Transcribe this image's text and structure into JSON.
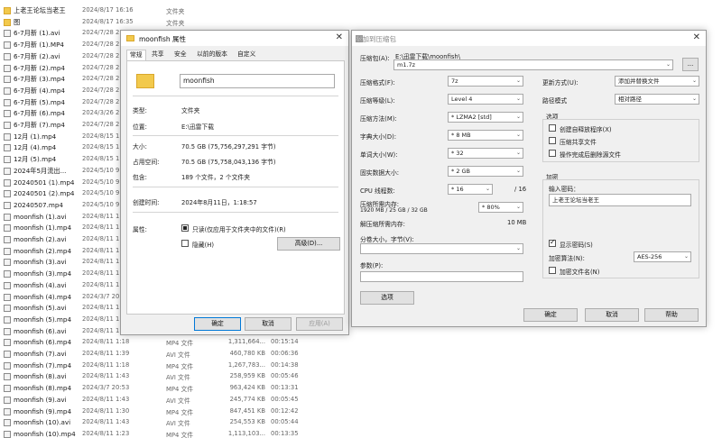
{
  "explorer": {
    "rows": [
      {
        "name": "上老王论坛当老王",
        "date": "2024/8/17 16:16",
        "type": "文件夹",
        "size": "",
        "duration": "",
        "icon": "folder"
      },
      {
        "name": "图",
        "date": "2024/8/17 16:35",
        "type": "文件夹",
        "size": "",
        "duration": "",
        "icon": "folder"
      },
      {
        "name": "6-7月新 (1).avi",
        "date": "2024/7/28 2",
        "type": "",
        "size": "",
        "duration": "",
        "icon": "file"
      },
      {
        "name": "6-7月新 (1).MP4",
        "date": "2024/7/28 2",
        "type": "",
        "size": "",
        "duration": "",
        "icon": "file"
      },
      {
        "name": "6-7月新 (2).avi",
        "date": "2024/7/28 2",
        "type": "",
        "size": "",
        "duration": "",
        "icon": "file"
      },
      {
        "name": "6-7月新 (2).mp4",
        "date": "2024/7/28 2",
        "type": "",
        "size": "",
        "duration": "",
        "icon": "file"
      },
      {
        "name": "6-7月新 (3).mp4",
        "date": "2024/7/28 2",
        "type": "",
        "size": "",
        "duration": "",
        "icon": "file"
      },
      {
        "name": "6-7月新 (4).mp4",
        "date": "2024/7/28 2",
        "type": "",
        "size": "",
        "duration": "",
        "icon": "file"
      },
      {
        "name": "6-7月新 (5).mp4",
        "date": "2024/7/28 2",
        "type": "",
        "size": "",
        "duration": "",
        "icon": "file"
      },
      {
        "name": "6-7月新 (6).mp4",
        "date": "2024/3/26 2",
        "type": "",
        "size": "",
        "duration": "",
        "icon": "file"
      },
      {
        "name": "6-7月新 (7).mp4",
        "date": "2024/7/28 2",
        "type": "",
        "size": "",
        "duration": "",
        "icon": "file"
      },
      {
        "name": "12月 (1).mp4",
        "date": "2024/8/15 1",
        "type": "",
        "size": "",
        "duration": "",
        "icon": "file"
      },
      {
        "name": "12月 (4).mp4",
        "date": "2024/8/15 1",
        "type": "",
        "size": "",
        "duration": "",
        "icon": "file"
      },
      {
        "name": "12月 (5).mp4",
        "date": "2024/8/15 1",
        "type": "",
        "size": "",
        "duration": "",
        "icon": "file"
      },
      {
        "name": "2024年5月流出...",
        "date": "2024/5/10 9",
        "type": "",
        "size": "",
        "duration": "",
        "icon": "file"
      },
      {
        "name": "20240501 (1).mp4",
        "date": "2024/5/10 9",
        "type": "",
        "size": "",
        "duration": "",
        "icon": "file"
      },
      {
        "name": "20240501 (2).mp4",
        "date": "2024/5/10 9",
        "type": "",
        "size": "",
        "duration": "",
        "icon": "file"
      },
      {
        "name": "20240507.mp4",
        "date": "2024/5/10 9",
        "type": "",
        "size": "",
        "duration": "",
        "icon": "file"
      },
      {
        "name": "moonfish (1).avi",
        "date": "2024/8/11 1",
        "type": "",
        "size": "",
        "duration": "",
        "icon": "file"
      },
      {
        "name": "moonfish (1).mp4",
        "date": "2024/8/11 1",
        "type": "",
        "size": "",
        "duration": "",
        "icon": "file"
      },
      {
        "name": "moonfish (2).avi",
        "date": "2024/8/11 1",
        "type": "",
        "size": "",
        "duration": "",
        "icon": "file"
      },
      {
        "name": "moonfish (2).mp4",
        "date": "2024/8/11 1",
        "type": "",
        "size": "",
        "duration": "",
        "icon": "file"
      },
      {
        "name": "moonfish (3).avi",
        "date": "2024/8/11 1",
        "type": "",
        "size": "",
        "duration": "",
        "icon": "file"
      },
      {
        "name": "moonfish (3).mp4",
        "date": "2024/8/11 1",
        "type": "",
        "size": "",
        "duration": "",
        "icon": "file"
      },
      {
        "name": "moonfish (4).avi",
        "date": "2024/8/11 1",
        "type": "",
        "size": "",
        "duration": "",
        "icon": "file"
      },
      {
        "name": "moonfish (4).mp4",
        "date": "2024/3/7 20",
        "type": "",
        "size": "",
        "duration": "",
        "icon": "file"
      },
      {
        "name": "moonfish (5).avi",
        "date": "2024/8/11 1",
        "type": "",
        "size": "",
        "duration": "",
        "icon": "file"
      },
      {
        "name": "moonfish (5).mp4",
        "date": "2024/8/11 1",
        "type": "",
        "size": "",
        "duration": "",
        "icon": "file"
      },
      {
        "name": "moonfish (6).avi",
        "date": "2024/8/11 1",
        "type": "",
        "size": "",
        "duration": "",
        "icon": "file"
      },
      {
        "name": "moonfish (6).mp4",
        "date": "2024/8/11 1:18",
        "type": "MP4 文件",
        "size": "1,311,664...",
        "duration": "00:15:14",
        "icon": "file"
      },
      {
        "name": "moonfish (7).avi",
        "date": "2024/8/11 1:39",
        "type": "AVI 文件",
        "size": "460,780 KB",
        "duration": "00:06:36",
        "icon": "file"
      },
      {
        "name": "moonfish (7).mp4",
        "date": "2024/8/11 1:18",
        "type": "MP4 文件",
        "size": "1,267,783...",
        "duration": "00:14:38",
        "icon": "file"
      },
      {
        "name": "moonfish (8).avi",
        "date": "2024/8/11 1:43",
        "type": "AVI 文件",
        "size": "258,959 KB",
        "duration": "00:05:46",
        "icon": "file"
      },
      {
        "name": "moonfish (8).mp4",
        "date": "2024/3/7 20:53",
        "type": "MP4 文件",
        "size": "963,424 KB",
        "duration": "00:13:31",
        "icon": "file"
      },
      {
        "name": "moonfish (9).avi",
        "date": "2024/8/11 1:43",
        "type": "AVI 文件",
        "size": "245,774 KB",
        "duration": "00:05:45",
        "icon": "file"
      },
      {
        "name": "moonfish (9).mp4",
        "date": "2024/8/11 1:30",
        "type": "MP4 文件",
        "size": "847,451 KB",
        "duration": "00:12:42",
        "icon": "file"
      },
      {
        "name": "moonfish (10).avi",
        "date": "2024/8/11 1:43",
        "type": "AVI 文件",
        "size": "254,553 KB",
        "duration": "00:05:44",
        "icon": "file"
      },
      {
        "name": "moonfish (10).mp4",
        "date": "2024/8/11 1:23",
        "type": "MP4 文件",
        "size": "1,113,103...",
        "duration": "00:13:35",
        "icon": "file"
      }
    ]
  },
  "props": {
    "title": "moonfish 属性",
    "tabs": [
      "常规",
      "共享",
      "安全",
      "以前的版本",
      "自定义"
    ],
    "name_value": "moonfish",
    "fields": [
      {
        "label": "类型:",
        "value": "文件夹"
      },
      {
        "label": "位置:",
        "value": "E:\\迅雷下载"
      },
      {
        "label": "大小:",
        "value": "70.5 GB (75,756,297,291 字节)"
      },
      {
        "label": "占用空间:",
        "value": "70.5 GB (75,758,043,136 字节)"
      },
      {
        "label": "包含:",
        "value": "189 个文件，2 个文件夹"
      },
      {
        "label": "创建时间:",
        "value": "2024年8月11日，1:18:57"
      }
    ],
    "attr_label": "属性:",
    "readonly_label": "只读(仅应用于文件夹中的文件)(R)",
    "hidden_label": "隐藏(H)",
    "advanced_label": "高级(D)...",
    "ok_label": "确定",
    "cancel_label": "取消",
    "apply_label": "应用(A)"
  },
  "archive": {
    "title": "添加到压缩包",
    "name_label": "压缩包(A):",
    "path_text": "E:\\迅雷下载\\moonfish\\",
    "file_value": "m1.7z",
    "browse_label": "...",
    "format_label": "压缩格式(F):",
    "format_value": "7z",
    "level_label": "压缩等级(L):",
    "level_value": "Level 4",
    "method_label": "压缩方法(M):",
    "method_value": "* LZMA2 [std]",
    "dict_label": "字典大小(D):",
    "dict_value": "* 8 MB",
    "word_label": "单词大小(W):",
    "word_value": "* 32",
    "solid_label": "固实数据大小:",
    "solid_value": "* 2 GB",
    "threads_label": "CPU 线程数:",
    "threads_value": "* 16",
    "threads_total": "/ 16",
    "mem_comp_label": "压缩所需内存:",
    "mem_comp_value": "1920 MB / 25 GB / 32 GB",
    "mem_pct": "* 80%",
    "mem_decomp_label": "解压缩所需内存:",
    "mem_decomp_value": "10 MB",
    "split_label": "分卷大小，字节(V):",
    "params_label": "参数(P):",
    "options_label": "选项",
    "update_label": "更新方式(U):",
    "update_value": "添加并替换文件",
    "pathmode_label": "路径模式",
    "pathmode_value": "相对路径",
    "opt_group_label": "选项",
    "opt_sfx": "创建自释放程序(X)",
    "opt_shared": "压缩共享文件",
    "opt_delete": "操作完成后删除源文件",
    "enc_group_label": "加密",
    "pwd_label": "输入密码：",
    "pwd_value": "上老王论坛当老王",
    "show_pwd": "显示密码(S)",
    "enc_method_label": "加密算法(N):",
    "enc_method_value": "AES-256",
    "enc_names": "加密文件名(N)",
    "ok_label": "确定",
    "cancel_label": "取消",
    "help_label": "帮助"
  }
}
